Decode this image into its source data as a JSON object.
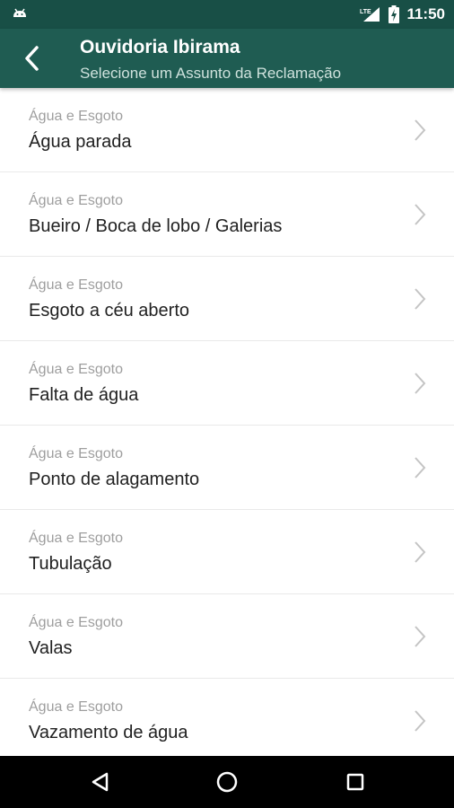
{
  "status_bar": {
    "time": "11:50",
    "network_label": "LTE",
    "icons": [
      "android-icon",
      "lte-signal-icon",
      "battery-charging-icon"
    ]
  },
  "app_bar": {
    "title": "Ouvidoria Ibirama",
    "subtitle": "Selecione um Assunto da Reclamação",
    "background_color": "#1f5c52",
    "status_bar_color": "#184f46"
  },
  "list": {
    "items": [
      {
        "category": "Água e Esgoto",
        "title": "Água parada"
      },
      {
        "category": "Água e Esgoto",
        "title": "Bueiro / Boca de lobo / Galerias"
      },
      {
        "category": "Água e Esgoto",
        "title": "Esgoto a céu aberto"
      },
      {
        "category": "Água e Esgoto",
        "title": "Falta de água"
      },
      {
        "category": "Água e Esgoto",
        "title": "Ponto de alagamento"
      },
      {
        "category": "Água e Esgoto",
        "title": "Tubulação"
      },
      {
        "category": "Água e Esgoto",
        "title": "Valas"
      },
      {
        "category": "Água e Esgoto",
        "title": "Vazamento de água"
      }
    ]
  },
  "nav_bar": {
    "buttons": [
      "back-triangle-icon",
      "home-circle-icon",
      "recents-square-icon"
    ]
  }
}
